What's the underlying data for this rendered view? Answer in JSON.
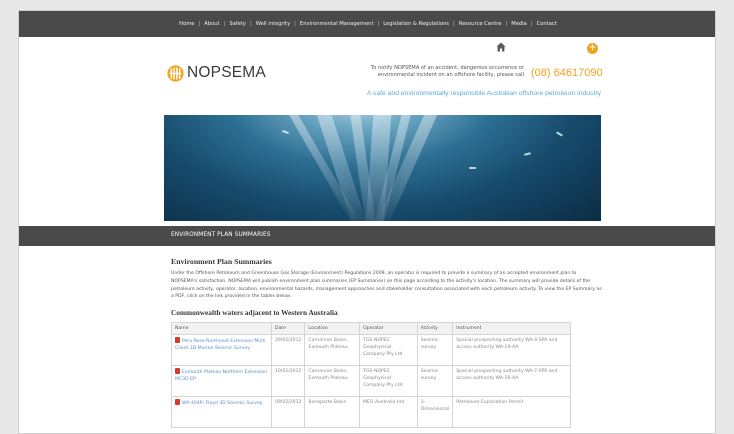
{
  "nav": {
    "items": [
      "Home",
      "About",
      "Safety",
      "Well integrity",
      "Environmental Management",
      "Legislation & Regulations",
      "Resource Centre",
      "Media",
      "Contact"
    ]
  },
  "header": {
    "logo_text": "NOPSEMA",
    "notify_text": "To notify NOPSEMA of an accident, dangerous occurrence or environmental incident on an offshore facility, please call",
    "phone": "(08) 64617090",
    "tagline": "A safe and environmentally responsible Australian offshore petroleum industry",
    "plus_label": "+"
  },
  "section": {
    "title": "ENVIRONMENT PLAN SUMMARIES"
  },
  "content": {
    "heading": "Environment Plan Summaries",
    "intro": "Under the Offshore Petroleum and Greenhouse Gas Storage (Environment) Regulations 2009, an operator is required to provide a summary of an accepted environment plan to NOPSEMA's satisfaction. NOPSEMA will publish environment plan summaries (EP Summaries) on this page according to the activity's location. The summary will provide details of the petroleum activity, operator, location, environmental hazards, management approaches and stakeholder consultation associated with each petroleum activity. To view the EP Summary as a PDF, click on the link provided in the tables below.",
    "subheading": "Commonwealth waters adjacent to Western Australia",
    "table": {
      "headers": [
        "Name",
        "Date",
        "Location",
        "Operator",
        "Activity",
        "Instrument"
      ],
      "rows": [
        [
          "Peru Rose Northeast Extension Multi Client 3D Marine Seismic Survey",
          "29/02/2012",
          "Carnarvon Basin, Exmouth Plateau",
          "TGS-NOPEC Geophysical Company Pty Ltd",
          "Seismic survey",
          "Special prospecting authority WA-4-SPA and access authority WA-19-AA"
        ],
        [
          "Exmouth Plateau Northern Extension MC3D EP",
          "10/02/2012",
          "Carnarvon Basin, Exmouth Plateau",
          "TGS-NOPEC Geophysical Company Pty Ltd",
          "Seismic survey",
          "Special prospecting authority WA-7-SPA and access authority WA-16-AA"
        ],
        [
          "WA-404P; Floyd 3D Seismic Survey",
          "09/02/2012",
          "Bonaparte Basin",
          "MEO Australia Ltd",
          "3-Dimensional",
          "Petroleum Exploration Permit"
        ]
      ]
    }
  },
  "colors": {
    "accent": "#f0a21b",
    "link": "#5b8fc2",
    "navbar": "#4a4a4a",
    "tagline": "#5aaad8"
  },
  "icons": {
    "home": "home-icon",
    "plus": "plus-icon",
    "pdf": "pdf-icon",
    "logo": "nopsema-logo-icon"
  }
}
